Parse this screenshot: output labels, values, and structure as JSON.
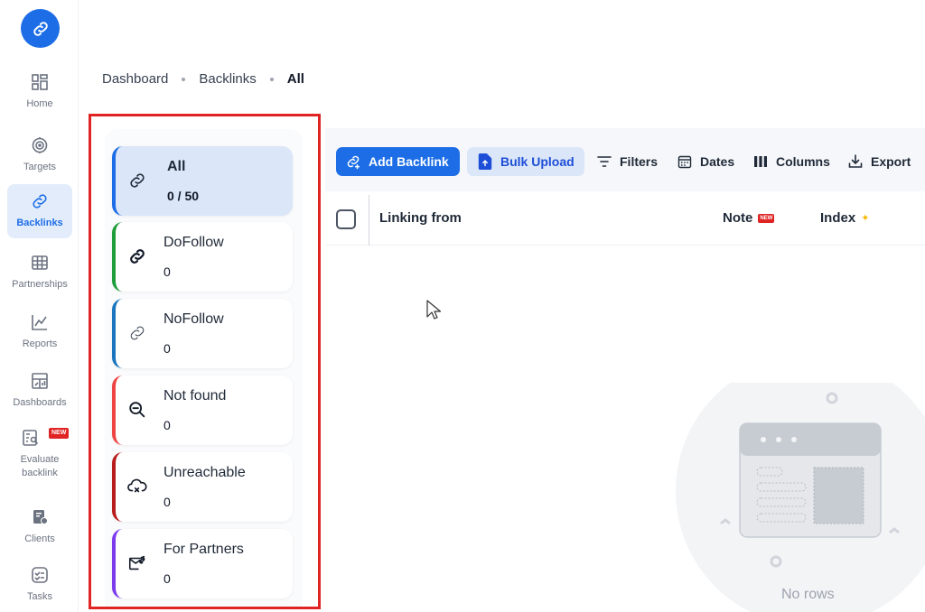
{
  "rail": {
    "items": [
      {
        "label": "Home",
        "icon": "home-icon"
      },
      {
        "label": "Targets",
        "icon": "target-icon"
      },
      {
        "label": "Backlinks",
        "icon": "link-icon",
        "active": true
      },
      {
        "label": "Partnerships",
        "icon": "table-icon"
      },
      {
        "label": "Reports",
        "icon": "chart-icon"
      },
      {
        "label": "Dashboards",
        "icon": "dashboard-icon"
      },
      {
        "label": "Evaluate backlink",
        "icon": "evaluate-icon",
        "badge": "NEW"
      },
      {
        "label": "Clients",
        "icon": "clients-icon"
      },
      {
        "label": "Tasks",
        "icon": "tasks-icon"
      }
    ]
  },
  "breadcrumb": {
    "items": [
      "Dashboard",
      "Backlinks",
      "All"
    ]
  },
  "categories": [
    {
      "title": "All",
      "count": "0 / 50",
      "accent": "#1d6ee6",
      "icon": "link-icon",
      "active": true
    },
    {
      "title": "DoFollow",
      "count": "0",
      "accent": "#1f9d3a",
      "icon": "link-bold-icon"
    },
    {
      "title": "NoFollow",
      "count": "0",
      "accent": "#1b75bc",
      "icon": "link-thin-icon"
    },
    {
      "title": "Not found",
      "count": "0",
      "accent": "#ef4444",
      "icon": "zoom-out-icon"
    },
    {
      "title": "Unreachable",
      "count": "0",
      "accent": "#b91c1c",
      "icon": "cloud-x-icon"
    },
    {
      "title": "For Partners",
      "count": "0",
      "accent": "#7c3aed",
      "icon": "mail-link-icon"
    }
  ],
  "toolbar": {
    "add_backlink": "Add Backlink",
    "bulk_upload": "Bulk Upload",
    "filters": "Filters",
    "dates": "Dates",
    "columns": "Columns",
    "export": "Export"
  },
  "table": {
    "columns": [
      "Linking from",
      "Note",
      "Index"
    ],
    "note_badge": "NEW",
    "empty_text": "No rows"
  },
  "colors": {
    "primary": "#1d6ee6",
    "highlight_border": "#e02424"
  }
}
